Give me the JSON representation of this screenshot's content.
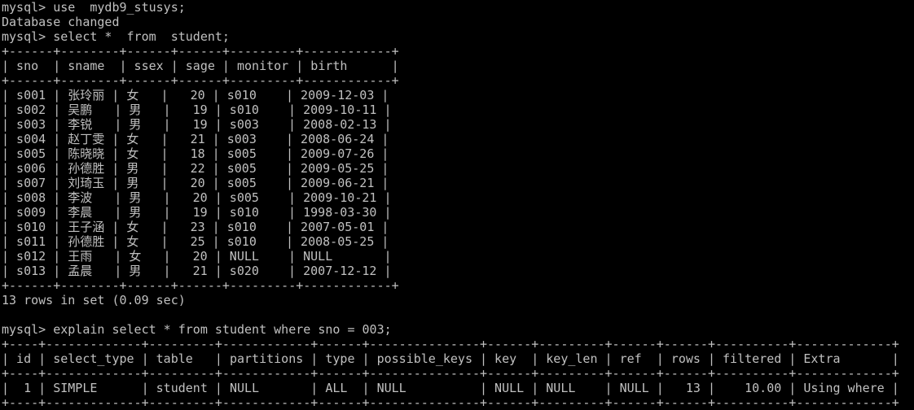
{
  "terminal": {
    "colors": {
      "background": "#000000",
      "foreground": "#c0c0c0"
    },
    "lines": [
      {
        "kind": "command",
        "prompt": "mysql> ",
        "text": "use  mydb9_stusys;"
      },
      {
        "kind": "output",
        "text": "Database changed"
      },
      {
        "kind": "command",
        "prompt": "mysql> ",
        "text": "select *  from  student;"
      },
      {
        "kind": "border",
        "text": "+------+--------+------+------+---------+------------+"
      },
      {
        "kind": "row",
        "text": "| sno  | sname  | ssex | sage | monitor | birth      |"
      },
      {
        "kind": "border",
        "text": "+------+--------+------+------+---------+------------+"
      },
      {
        "kind": "row",
        "text": "| s001 | 张玲丽 | 女   |   20 | s010    | 2009-12-03 |"
      },
      {
        "kind": "row",
        "text": "| s002 | 吴鹏   | 男   |   19 | s010    | 2009-10-11 |"
      },
      {
        "kind": "row",
        "text": "| s003 | 李锐   | 男   |   19 | s003    | 2008-02-13 |"
      },
      {
        "kind": "row",
        "text": "| s004 | 赵丁雯 | 女   |   21 | s003    | 2008-06-24 |"
      },
      {
        "kind": "row",
        "text": "| s005 | 陈晓晓 | 女   |   18 | s005    | 2009-07-26 |"
      },
      {
        "kind": "row",
        "text": "| s006 | 孙德胜 | 男   |   22 | s005    | 2009-05-25 |"
      },
      {
        "kind": "row",
        "text": "| s007 | 刘琦玉 | 男   |   20 | s005    | 2009-06-21 |"
      },
      {
        "kind": "row",
        "text": "| s008 | 李波   | 男   |   20 | s005    | 2009-10-21 |"
      },
      {
        "kind": "row",
        "text": "| s009 | 李晨   | 男   |   19 | s010    | 1998-03-30 |"
      },
      {
        "kind": "row",
        "text": "| s010 | 王子涵 | 女   |   23 | s010    | 2007-05-01 |"
      },
      {
        "kind": "row",
        "text": "| s011 | 孙德胜 | 女   |   25 | s010    | 2008-05-25 |"
      },
      {
        "kind": "row",
        "text": "| s012 | 王雨   | 女   |   20 | NULL    | NULL       |"
      },
      {
        "kind": "row",
        "text": "| s013 | 孟晨   | 男   |   21 | s020    | 2007-12-12 |"
      },
      {
        "kind": "border",
        "text": "+------+--------+------+------+---------+------------+"
      },
      {
        "kind": "output",
        "text": "13 rows in set (0.09 sec)"
      },
      {
        "kind": "blank",
        "text": ""
      },
      {
        "kind": "command",
        "prompt": "mysql> ",
        "text": "explain select * from student where sno = 003;"
      },
      {
        "kind": "border",
        "text": "+----+-------------+---------+------------+------+---------------+------+---------+------+------+----------+-------------+"
      },
      {
        "kind": "row",
        "text": "| id | select_type | table   | partitions | type | possible_keys | key  | key_len | ref  | rows | filtered | Extra       |"
      },
      {
        "kind": "border",
        "text": "+----+-------------+---------+------------+------+---------------+------+---------+------+------+----------+-------------+"
      },
      {
        "kind": "row",
        "text": "|  1 | SIMPLE      | student | NULL       | ALL  | NULL          | NULL | NULL    | NULL |   13 |    10.00 | Using where |"
      },
      {
        "kind": "border",
        "text": "+----+-------------+---------+------------+------+---------------+------+---------+------+------+----------+-------------+"
      }
    ]
  }
}
